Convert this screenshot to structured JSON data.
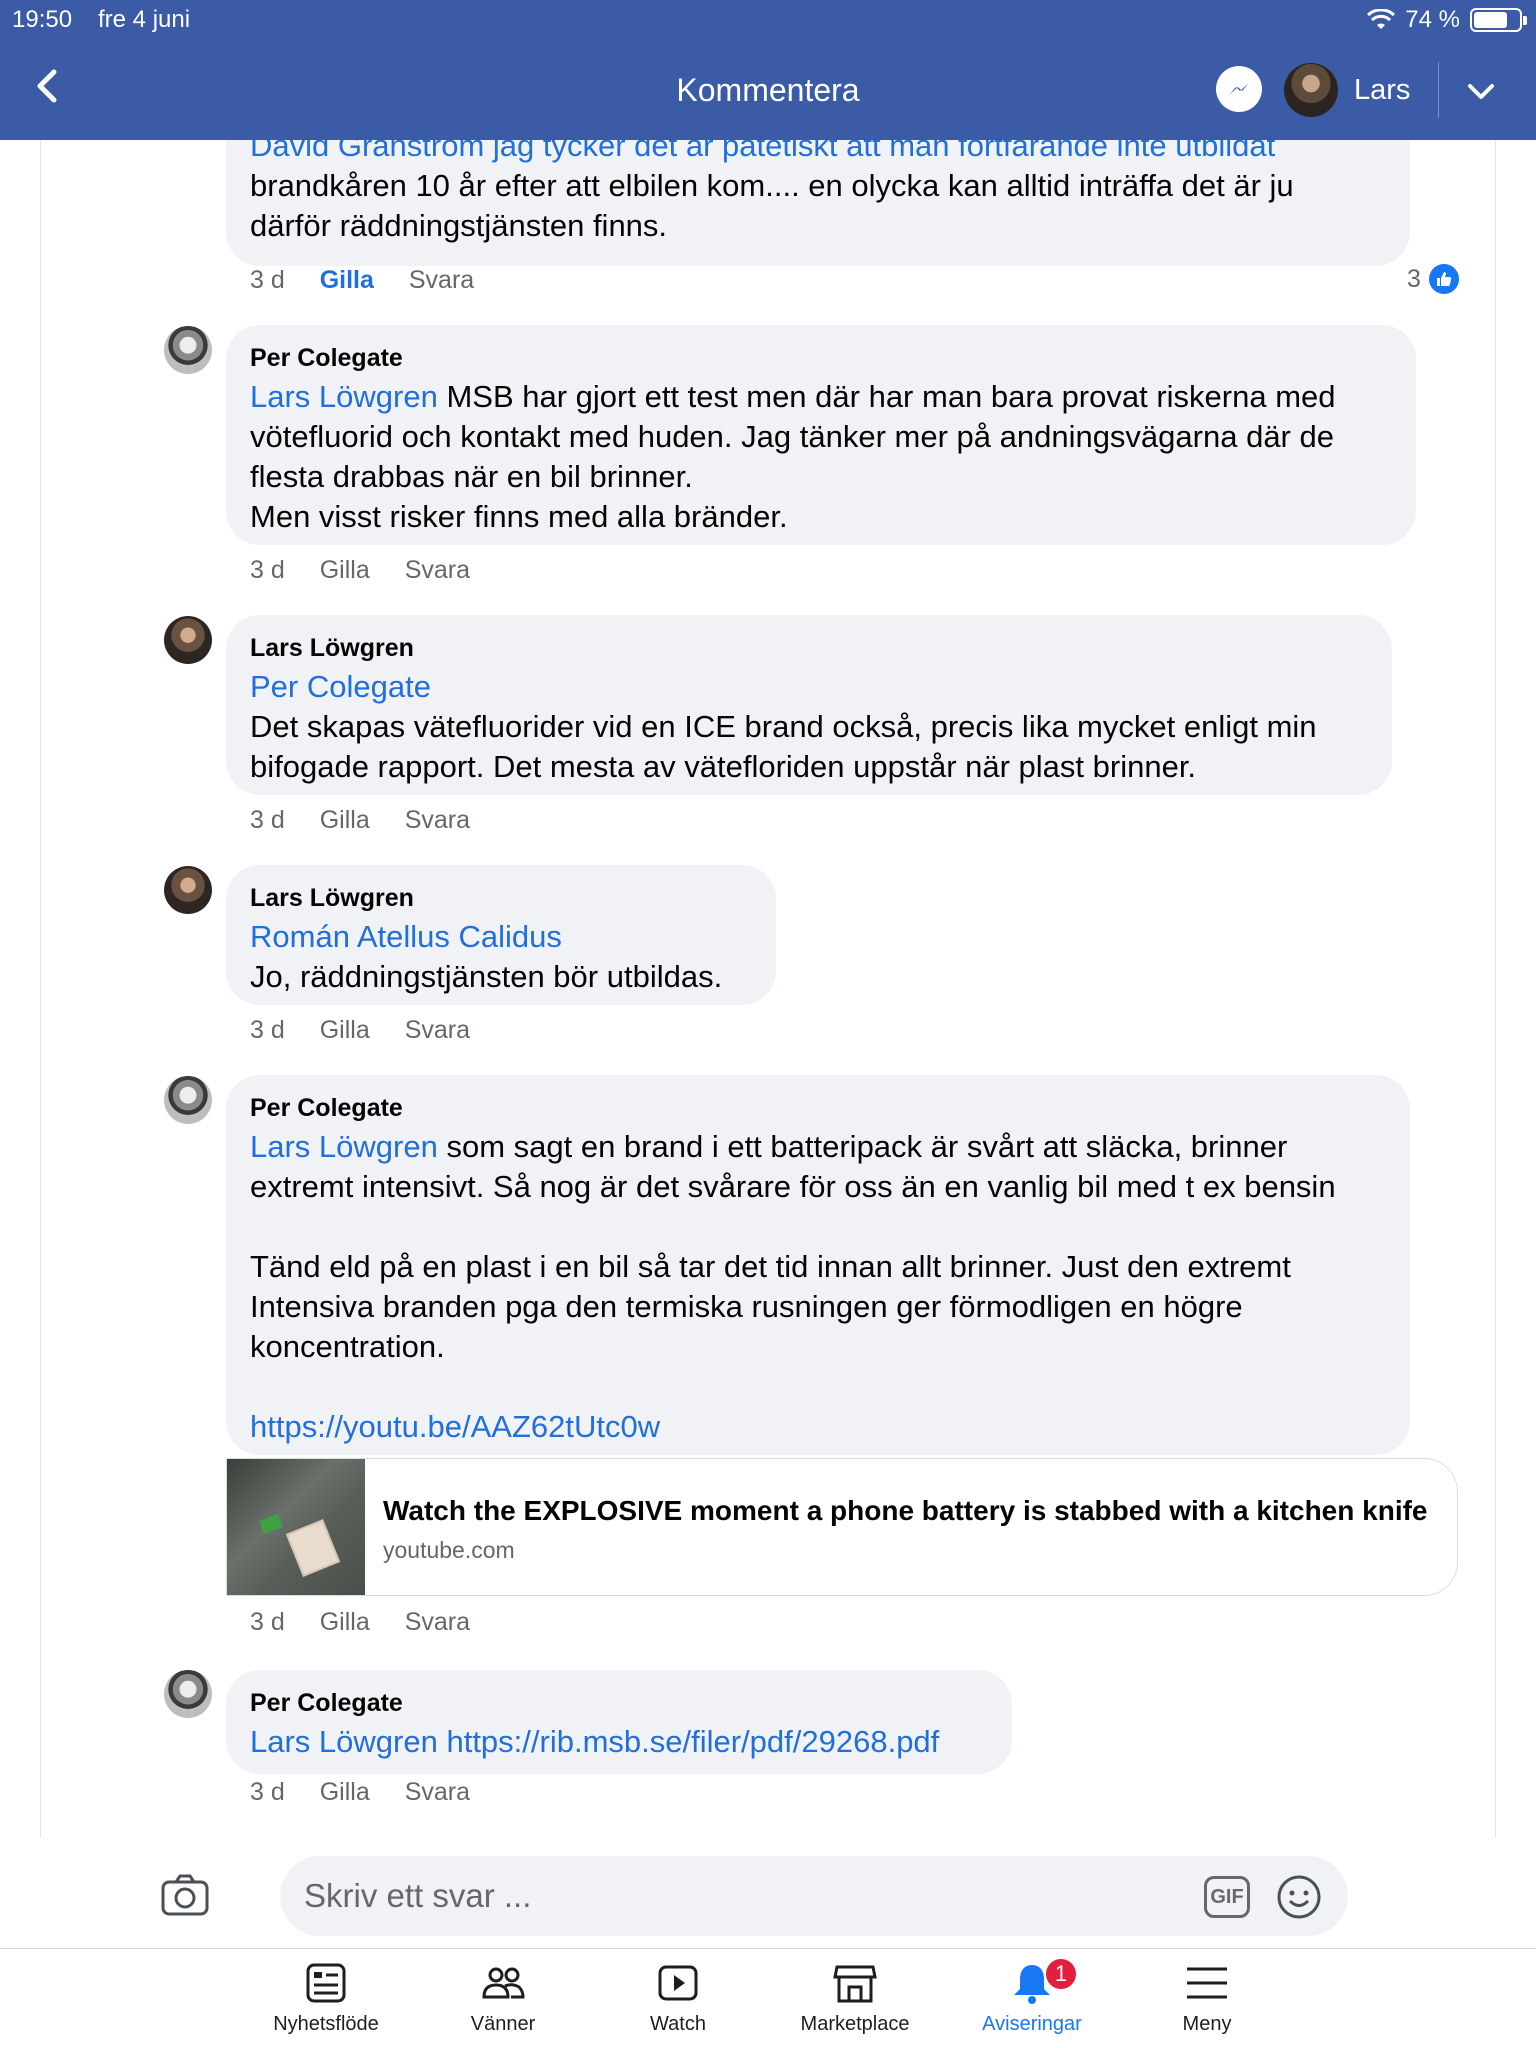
{
  "status_bar": {
    "time": "19:50",
    "date": "fre 4 juni",
    "battery": "74 %"
  },
  "header": {
    "title": "Kommentera",
    "user_name": "Lars"
  },
  "comments": [
    {
      "text_lines": [
        "David Granström jag tycker det är patetiskt att man fortfarande inte utbildat",
        "brandkåren 10 år efter att elbilen kom.... en olycka kan alltid inträffa det är ju",
        "därför räddningstjänsten finns."
      ],
      "time": "3 d",
      "like_label": "Gilla",
      "reply_label": "Svara",
      "like_count": "3"
    },
    {
      "author": "Per Colegate",
      "mention": "Lars Löwgren",
      "text_first": " MSB har gjort ett test men där har man bara provat riskerna med",
      "text_lines": [
        "vötefluorid och kontakt med huden. Jag tänker mer på andningsvägarna där de",
        "flesta drabbas när en bil brinner.",
        "Men visst risker finns med alla bränder."
      ],
      "time": "3 d",
      "like_label": "Gilla",
      "reply_label": "Svara"
    },
    {
      "author": "Lars Löwgren",
      "mention": "Per Colegate",
      "text_lines": [
        "Det skapas vätefluorider vid en ICE brand också, precis lika mycket enligt min",
        "bifogade rapport. Det mesta av vätefloriden uppstår när plast brinner."
      ],
      "time": "3 d",
      "like_label": "Gilla",
      "reply_label": "Svara"
    },
    {
      "author": "Lars Löwgren",
      "mention": "Román Atellus Calidus",
      "text_lines": [
        "Jo, räddningstjänsten bör utbildas."
      ],
      "time": "3 d",
      "like_label": "Gilla",
      "reply_label": "Svara"
    },
    {
      "author": "Per Colegate",
      "mention": "Lars Löwgren",
      "text_first": " som sagt en brand i ett batteripack är svårt att släcka, brinner",
      "text_lines": [
        "extremt intensivt. Så nog är det svårare för oss än en vanlig bil med t ex bensin",
        "",
        "Tänd eld på en plast i en bil så tar det tid innan allt brinner. Just den extremt",
        "Intensiva branden pga den termiska rusningen ger förmodligen en högre",
        "koncentration.",
        ""
      ],
      "link": "https://youtu.be/AAZ62tUtc0w",
      "card_title": "Watch the EXPLOSIVE moment a phone battery is stabbed with a kitchen knife",
      "card_domain": "youtube.com",
      "time": "3 d",
      "like_label": "Gilla",
      "reply_label": "Svara"
    },
    {
      "author": "Per Colegate",
      "mention": "Lars Löwgren",
      "link": "https://rib.msb.se/filer/pdf/29268.pdf",
      "time": "3 d",
      "like_label": "Gilla",
      "reply_label": "Svara"
    }
  ],
  "composer": {
    "placeholder": "Skriv ett svar ...",
    "gif_label": "GIF"
  },
  "tabbar": [
    {
      "label": "Nyhetsflöde",
      "icon": "newsfeed-icon"
    },
    {
      "label": "Vänner",
      "icon": "friends-icon"
    },
    {
      "label": "Watch",
      "icon": "watch-icon"
    },
    {
      "label": "Marketplace",
      "icon": "marketplace-icon"
    },
    {
      "label": "Aviseringar",
      "icon": "bell-icon",
      "badge": "1"
    },
    {
      "label": "Meny",
      "icon": "menu-icon"
    }
  ],
  "colors": {
    "header": "#3b5ba6",
    "accent": "#216fdb",
    "bubble": "#f0f2f5",
    "badge": "#e41e3f"
  }
}
